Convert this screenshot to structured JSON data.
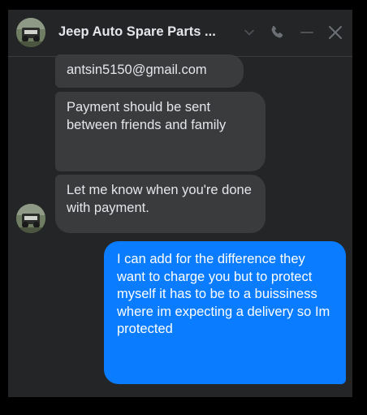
{
  "chat": {
    "title": "Jeep Auto Spare Parts ...",
    "avatar_icon": "jeep-avatar"
  },
  "header_icons": [
    "chevron-down-icon",
    "phone-icon",
    "minimize-icon",
    "close-icon"
  ],
  "colors": {
    "background": "#242526",
    "incoming_bubble": "#3a3b3c",
    "outgoing_bubble": "#0a7cff",
    "text": "#e4e6eb",
    "icon": "#b0b3b8"
  },
  "messages": [
    {
      "direction": "incoming",
      "text": "antsin5150@gmail.com"
    },
    {
      "direction": "incoming",
      "text": "Payment should be sent between friends and family"
    },
    {
      "direction": "incoming",
      "text": "Let me know when you're done with payment."
    },
    {
      "direction": "outgoing",
      "text": "I can add for the difference they want to charge you but to protect myself it has to be to a buissiness where im expecting a delivery so Im protected"
    }
  ]
}
